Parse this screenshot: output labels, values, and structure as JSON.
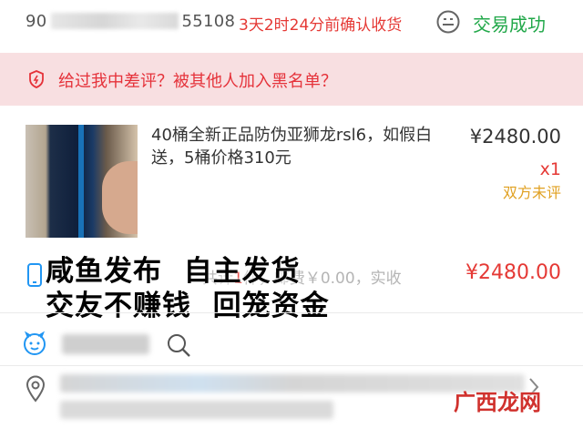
{
  "header": {
    "order_id_prefix": "90",
    "order_id_suffix": "55108",
    "confirm_countdown": "3天2时24分前确认收货",
    "trade_status": "交易成功"
  },
  "warning": {
    "text": "给过我中差评？被其他人加入黑名单？"
  },
  "product": {
    "title": "40桶全新正品防伪亚狮龙rsl6，如假白送，5桶价格310元",
    "price": "¥2480.00",
    "quantity": "x1",
    "review_status": "双方未评"
  },
  "summary": {
    "text_a": "共计",
    "count": "1",
    "text_b": "件，邮费￥0.00，实收",
    "total": "¥2480.00"
  },
  "overlay": {
    "line1": "咸鱼发布  自主发货",
    "line2": "交友不赚钱  回笼资金"
  },
  "watermark": "广西龙网",
  "colors": {
    "red": "#e53935",
    "green": "#22a84a",
    "banner_bg": "#f8dfe1",
    "gold": "#e0a020"
  },
  "icons": [
    "smiley-face-icon",
    "shield-icon",
    "phone-icon",
    "emoji-icon",
    "search-icon",
    "location-pin-icon",
    "chevron-right-icon"
  ]
}
